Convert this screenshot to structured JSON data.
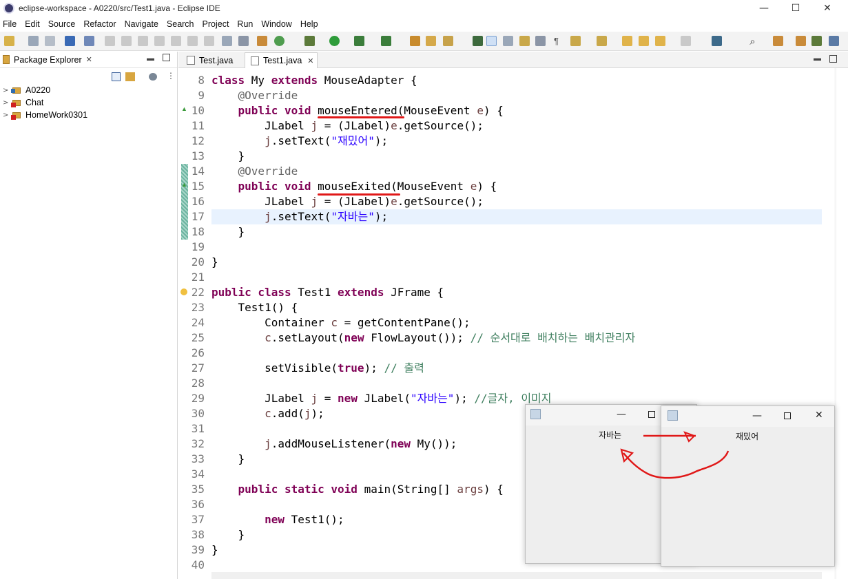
{
  "window": {
    "title": "eclipse-workspace - A0220/src/Test1.java - Eclipse IDE",
    "minimize_glyph": "—",
    "maximize_glyph": "☐",
    "close_glyph": "✕"
  },
  "menu": [
    "File",
    "Edit",
    "Source",
    "Refactor",
    "Navigate",
    "Search",
    "Project",
    "Run",
    "Window",
    "Help"
  ],
  "package_explorer": {
    "title": "Package Explorer",
    "projects": [
      "A0220",
      "Chat",
      "HomeWork0301"
    ]
  },
  "editor": {
    "tabs": [
      {
        "label": "Test.java",
        "active": false
      },
      {
        "label": "Test1.java",
        "active": true
      }
    ],
    "lines": [
      {
        "n": "8",
        "tokens": [
          [
            "kw",
            "class "
          ],
          [
            "",
            "My "
          ],
          [
            "kw",
            "extends "
          ],
          [
            "",
            "MouseAdapter {"
          ]
        ]
      },
      {
        "n": "9",
        "tokens": [
          [
            "",
            "    "
          ],
          [
            "ann",
            "@Override"
          ]
        ]
      },
      {
        "n": "10",
        "tokens": [
          [
            "",
            "    "
          ],
          [
            "kw",
            "public void "
          ],
          [
            "",
            "mouseEntered(MouseEvent "
          ],
          [
            "var",
            "e"
          ],
          [
            "",
            ") {"
          ]
        ]
      },
      {
        "n": "11",
        "tokens": [
          [
            "",
            "        JLabel "
          ],
          [
            "var",
            "j"
          ],
          [
            "",
            " = (JLabel)"
          ],
          [
            "var",
            "e"
          ],
          [
            "",
            ".getSource();"
          ]
        ]
      },
      {
        "n": "12",
        "tokens": [
          [
            "",
            "        "
          ],
          [
            "var",
            "j"
          ],
          [
            "",
            ".setText("
          ],
          [
            "str",
            "\"재밌어\""
          ],
          [
            "",
            ");"
          ]
        ]
      },
      {
        "n": "13",
        "tokens": [
          [
            "",
            "    }"
          ]
        ]
      },
      {
        "n": "14",
        "tokens": [
          [
            "",
            "    "
          ],
          [
            "ann",
            "@Override"
          ]
        ]
      },
      {
        "n": "15",
        "tokens": [
          [
            "",
            "    "
          ],
          [
            "kw",
            "public void "
          ],
          [
            "",
            "mouseExited(MouseEvent "
          ],
          [
            "var",
            "e"
          ],
          [
            "",
            ") {"
          ]
        ]
      },
      {
        "n": "16",
        "tokens": [
          [
            "",
            "        JLabel "
          ],
          [
            "var",
            "j"
          ],
          [
            "",
            " = (JLabel)"
          ],
          [
            "var",
            "e"
          ],
          [
            "",
            ".getSource();"
          ]
        ]
      },
      {
        "n": "17",
        "tokens": [
          [
            "",
            "        "
          ],
          [
            "var",
            "j"
          ],
          [
            "",
            ".setText("
          ],
          [
            "str",
            "\"자바는\""
          ],
          [
            "",
            ");"
          ]
        ]
      },
      {
        "n": "18",
        "tokens": [
          [
            "",
            "    }"
          ]
        ]
      },
      {
        "n": "19",
        "tokens": []
      },
      {
        "n": "20",
        "tokens": [
          [
            "",
            "}"
          ]
        ]
      },
      {
        "n": "21",
        "tokens": []
      },
      {
        "n": "22",
        "tokens": [
          [
            "kw",
            "public class "
          ],
          [
            "",
            "Test1 "
          ],
          [
            "kw",
            "extends "
          ],
          [
            "",
            "JFrame {"
          ]
        ]
      },
      {
        "n": "23",
        "tokens": [
          [
            "",
            "    Test1() {"
          ]
        ]
      },
      {
        "n": "24",
        "tokens": [
          [
            "",
            "        Container "
          ],
          [
            "var",
            "c"
          ],
          [
            "",
            " = getContentPane();"
          ]
        ]
      },
      {
        "n": "25",
        "tokens": [
          [
            "",
            "        "
          ],
          [
            "var",
            "c"
          ],
          [
            "",
            ".setLayout("
          ],
          [
            "kw",
            "new "
          ],
          [
            "",
            "FlowLayout()); "
          ],
          [
            "cmt",
            "// 순서대로 배치하는 배치관리자"
          ]
        ]
      },
      {
        "n": "26",
        "tokens": []
      },
      {
        "n": "27",
        "tokens": [
          [
            "",
            "        setVisible("
          ],
          [
            "kw",
            "true"
          ],
          [
            "",
            "); "
          ],
          [
            "cmt",
            "// 출력"
          ]
        ]
      },
      {
        "n": "28",
        "tokens": []
      },
      {
        "n": "29",
        "tokens": [
          [
            "",
            "        JLabel "
          ],
          [
            "var",
            "j"
          ],
          [
            "",
            " = "
          ],
          [
            "kw",
            "new "
          ],
          [
            "",
            "JLabel("
          ],
          [
            "str",
            "\"자바는\""
          ],
          [
            "",
            "); "
          ],
          [
            "cmt",
            "//글자, 이미지"
          ]
        ]
      },
      {
        "n": "30",
        "tokens": [
          [
            "",
            "        "
          ],
          [
            "var",
            "c"
          ],
          [
            "",
            ".add("
          ],
          [
            "var",
            "j"
          ],
          [
            "",
            ");"
          ]
        ]
      },
      {
        "n": "31",
        "tokens": []
      },
      {
        "n": "32",
        "tokens": [
          [
            "",
            "        "
          ],
          [
            "var",
            "j"
          ],
          [
            "",
            ".addMouseListener("
          ],
          [
            "kw",
            "new "
          ],
          [
            "",
            "My());"
          ]
        ]
      },
      {
        "n": "33",
        "tokens": [
          [
            "",
            "    }"
          ]
        ]
      },
      {
        "n": "34",
        "tokens": []
      },
      {
        "n": "35",
        "tokens": [
          [
            "",
            "    "
          ],
          [
            "kw",
            "public static void "
          ],
          [
            "",
            "main(String[] "
          ],
          [
            "var",
            "args"
          ],
          [
            "",
            ") {"
          ]
        ]
      },
      {
        "n": "36",
        "tokens": []
      },
      {
        "n": "37",
        "tokens": [
          [
            "",
            "        "
          ],
          [
            "kw",
            "new "
          ],
          [
            "",
            "Test1();"
          ]
        ]
      },
      {
        "n": "38",
        "tokens": [
          [
            "",
            "    }"
          ]
        ]
      },
      {
        "n": "39",
        "tokens": [
          [
            "",
            "}"
          ]
        ]
      },
      {
        "n": "40",
        "tokens": []
      }
    ]
  },
  "swing_windows": [
    {
      "label": "자바는"
    },
    {
      "label": "재밌어"
    }
  ],
  "colors": {
    "keyword": "#7f0055",
    "string": "#2a00ff",
    "comment": "#3f7f5f",
    "annotation": "#646464",
    "highlight_line": "#e8f2fe",
    "red_marks": "#e01818"
  }
}
